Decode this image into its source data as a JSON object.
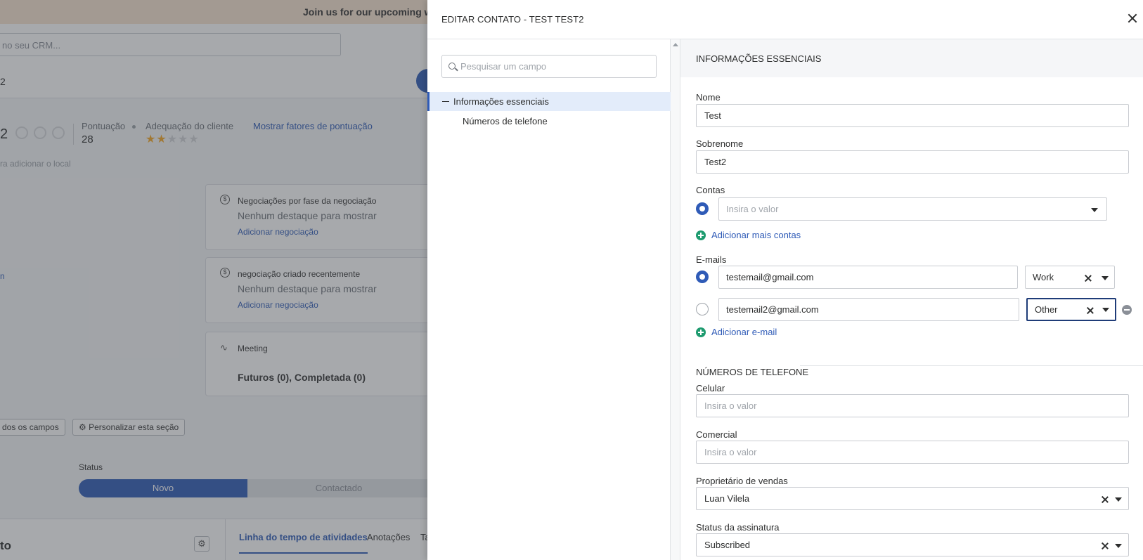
{
  "background": {
    "banner_text": "Join us for our upcoming we",
    "search_placeholder": "no seu CRM...",
    "record_name_fragment": "2",
    "record_name_big": "2",
    "score_label": "Pontuação",
    "score_value": "28",
    "fit_label": "Adequação do cliente",
    "fit_stars": 2,
    "fit_stars_max": 5,
    "score_factors_link": "Mostrar fatores de pontuação",
    "location_hint": "ra adicionar o local",
    "side_link": "n",
    "cards": [
      {
        "title": "Negociações por fase da negociação",
        "subtitle": "Nenhum destaque para mostrar",
        "link": "Adicionar negociação"
      },
      {
        "title": "negociação criado recentemente",
        "subtitle": "Nenhum destaque para mostrar",
        "link": "Adicionar negociação"
      },
      {
        "title": "Meeting",
        "body": "Futuros (0), Completada (0)"
      }
    ],
    "btn_all_fields": "dos os campos",
    "btn_customize": "Personalizar esta seção",
    "status_label": "Status",
    "pipeline": [
      "Novo",
      "Contactado"
    ],
    "bottom_title": "to",
    "tabs": [
      "Linha do tempo de atividades",
      "Anotações",
      "Ta"
    ]
  },
  "panel": {
    "title": "EDITAR CONTATO - TEST TEST2",
    "nav": {
      "search_placeholder": "Pesquisar um campo",
      "items": [
        "Informações essenciais",
        "Números de telefone"
      ]
    },
    "form": {
      "section_title": "INFORMAÇÕES ESSENCIAIS",
      "first_name_label": "Nome",
      "first_name_value": "Test",
      "last_name_label": "Sobrenome",
      "last_name_value": "Test2",
      "accounts_label": "Contas",
      "accounts_placeholder": "Insira o valor",
      "add_accounts": "Adicionar mais contas",
      "emails_label": "E-mails",
      "emails": [
        {
          "value": "testemail@gmail.com",
          "type": "Work",
          "primary": true
        },
        {
          "value": "testemail2@gmail.com",
          "type": "Other",
          "primary": false
        }
      ],
      "add_email": "Adicionar e-mail",
      "phone_section_title": "NÚMEROS DE TELEFONE",
      "mobile_label": "Celular",
      "mobile_placeholder": "Insira o valor",
      "business_label": "Comercial",
      "business_placeholder": "Insira o valor",
      "owner_label": "Proprietário de vendas",
      "owner_value": "Luan Vilela",
      "subscription_label": "Status da assinatura",
      "subscription_value": "Subscribed"
    }
  }
}
